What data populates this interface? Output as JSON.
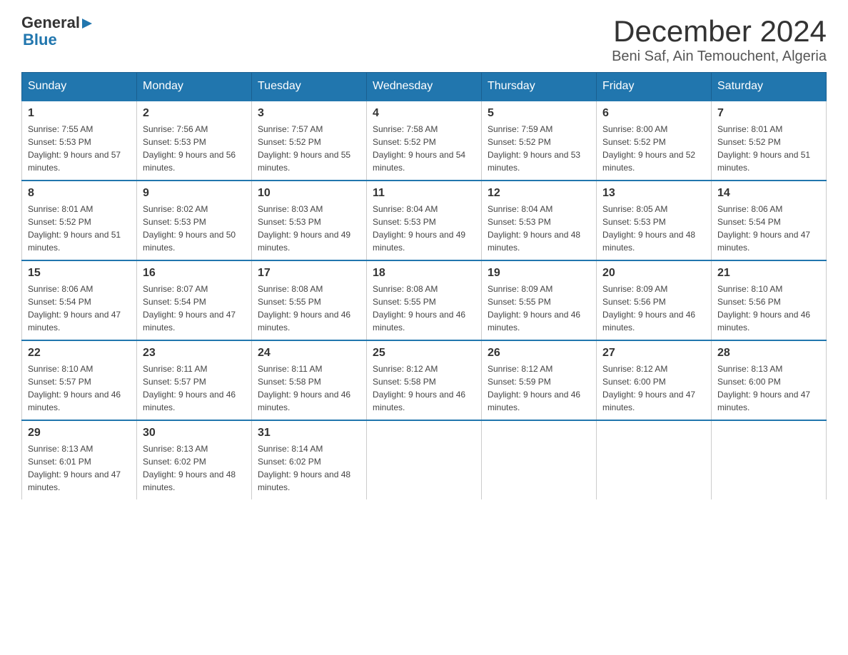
{
  "header": {
    "logo": {
      "general": "General",
      "arrow": "▶",
      "blue": "Blue"
    },
    "month_title": "December 2024",
    "location": "Beni Saf, Ain Temouchent, Algeria"
  },
  "days_of_week": [
    "Sunday",
    "Monday",
    "Tuesday",
    "Wednesday",
    "Thursday",
    "Friday",
    "Saturday"
  ],
  "weeks": [
    [
      {
        "day": "1",
        "sunrise": "7:55 AM",
        "sunset": "5:53 PM",
        "daylight": "9 hours and 57 minutes."
      },
      {
        "day": "2",
        "sunrise": "7:56 AM",
        "sunset": "5:53 PM",
        "daylight": "9 hours and 56 minutes."
      },
      {
        "day": "3",
        "sunrise": "7:57 AM",
        "sunset": "5:52 PM",
        "daylight": "9 hours and 55 minutes."
      },
      {
        "day": "4",
        "sunrise": "7:58 AM",
        "sunset": "5:52 PM",
        "daylight": "9 hours and 54 minutes."
      },
      {
        "day": "5",
        "sunrise": "7:59 AM",
        "sunset": "5:52 PM",
        "daylight": "9 hours and 53 minutes."
      },
      {
        "day": "6",
        "sunrise": "8:00 AM",
        "sunset": "5:52 PM",
        "daylight": "9 hours and 52 minutes."
      },
      {
        "day": "7",
        "sunrise": "8:01 AM",
        "sunset": "5:52 PM",
        "daylight": "9 hours and 51 minutes."
      }
    ],
    [
      {
        "day": "8",
        "sunrise": "8:01 AM",
        "sunset": "5:52 PM",
        "daylight": "9 hours and 51 minutes."
      },
      {
        "day": "9",
        "sunrise": "8:02 AM",
        "sunset": "5:53 PM",
        "daylight": "9 hours and 50 minutes."
      },
      {
        "day": "10",
        "sunrise": "8:03 AM",
        "sunset": "5:53 PM",
        "daylight": "9 hours and 49 minutes."
      },
      {
        "day": "11",
        "sunrise": "8:04 AM",
        "sunset": "5:53 PM",
        "daylight": "9 hours and 49 minutes."
      },
      {
        "day": "12",
        "sunrise": "8:04 AM",
        "sunset": "5:53 PM",
        "daylight": "9 hours and 48 minutes."
      },
      {
        "day": "13",
        "sunrise": "8:05 AM",
        "sunset": "5:53 PM",
        "daylight": "9 hours and 48 minutes."
      },
      {
        "day": "14",
        "sunrise": "8:06 AM",
        "sunset": "5:54 PM",
        "daylight": "9 hours and 47 minutes."
      }
    ],
    [
      {
        "day": "15",
        "sunrise": "8:06 AM",
        "sunset": "5:54 PM",
        "daylight": "9 hours and 47 minutes."
      },
      {
        "day": "16",
        "sunrise": "8:07 AM",
        "sunset": "5:54 PM",
        "daylight": "9 hours and 47 minutes."
      },
      {
        "day": "17",
        "sunrise": "8:08 AM",
        "sunset": "5:55 PM",
        "daylight": "9 hours and 46 minutes."
      },
      {
        "day": "18",
        "sunrise": "8:08 AM",
        "sunset": "5:55 PM",
        "daylight": "9 hours and 46 minutes."
      },
      {
        "day": "19",
        "sunrise": "8:09 AM",
        "sunset": "5:55 PM",
        "daylight": "9 hours and 46 minutes."
      },
      {
        "day": "20",
        "sunrise": "8:09 AM",
        "sunset": "5:56 PM",
        "daylight": "9 hours and 46 minutes."
      },
      {
        "day": "21",
        "sunrise": "8:10 AM",
        "sunset": "5:56 PM",
        "daylight": "9 hours and 46 minutes."
      }
    ],
    [
      {
        "day": "22",
        "sunrise": "8:10 AM",
        "sunset": "5:57 PM",
        "daylight": "9 hours and 46 minutes."
      },
      {
        "day": "23",
        "sunrise": "8:11 AM",
        "sunset": "5:57 PM",
        "daylight": "9 hours and 46 minutes."
      },
      {
        "day": "24",
        "sunrise": "8:11 AM",
        "sunset": "5:58 PM",
        "daylight": "9 hours and 46 minutes."
      },
      {
        "day": "25",
        "sunrise": "8:12 AM",
        "sunset": "5:58 PM",
        "daylight": "9 hours and 46 minutes."
      },
      {
        "day": "26",
        "sunrise": "8:12 AM",
        "sunset": "5:59 PM",
        "daylight": "9 hours and 46 minutes."
      },
      {
        "day": "27",
        "sunrise": "8:12 AM",
        "sunset": "6:00 PM",
        "daylight": "9 hours and 47 minutes."
      },
      {
        "day": "28",
        "sunrise": "8:13 AM",
        "sunset": "6:00 PM",
        "daylight": "9 hours and 47 minutes."
      }
    ],
    [
      {
        "day": "29",
        "sunrise": "8:13 AM",
        "sunset": "6:01 PM",
        "daylight": "9 hours and 47 minutes."
      },
      {
        "day": "30",
        "sunrise": "8:13 AM",
        "sunset": "6:02 PM",
        "daylight": "9 hours and 48 minutes."
      },
      {
        "day": "31",
        "sunrise": "8:14 AM",
        "sunset": "6:02 PM",
        "daylight": "9 hours and 48 minutes."
      },
      null,
      null,
      null,
      null
    ]
  ]
}
